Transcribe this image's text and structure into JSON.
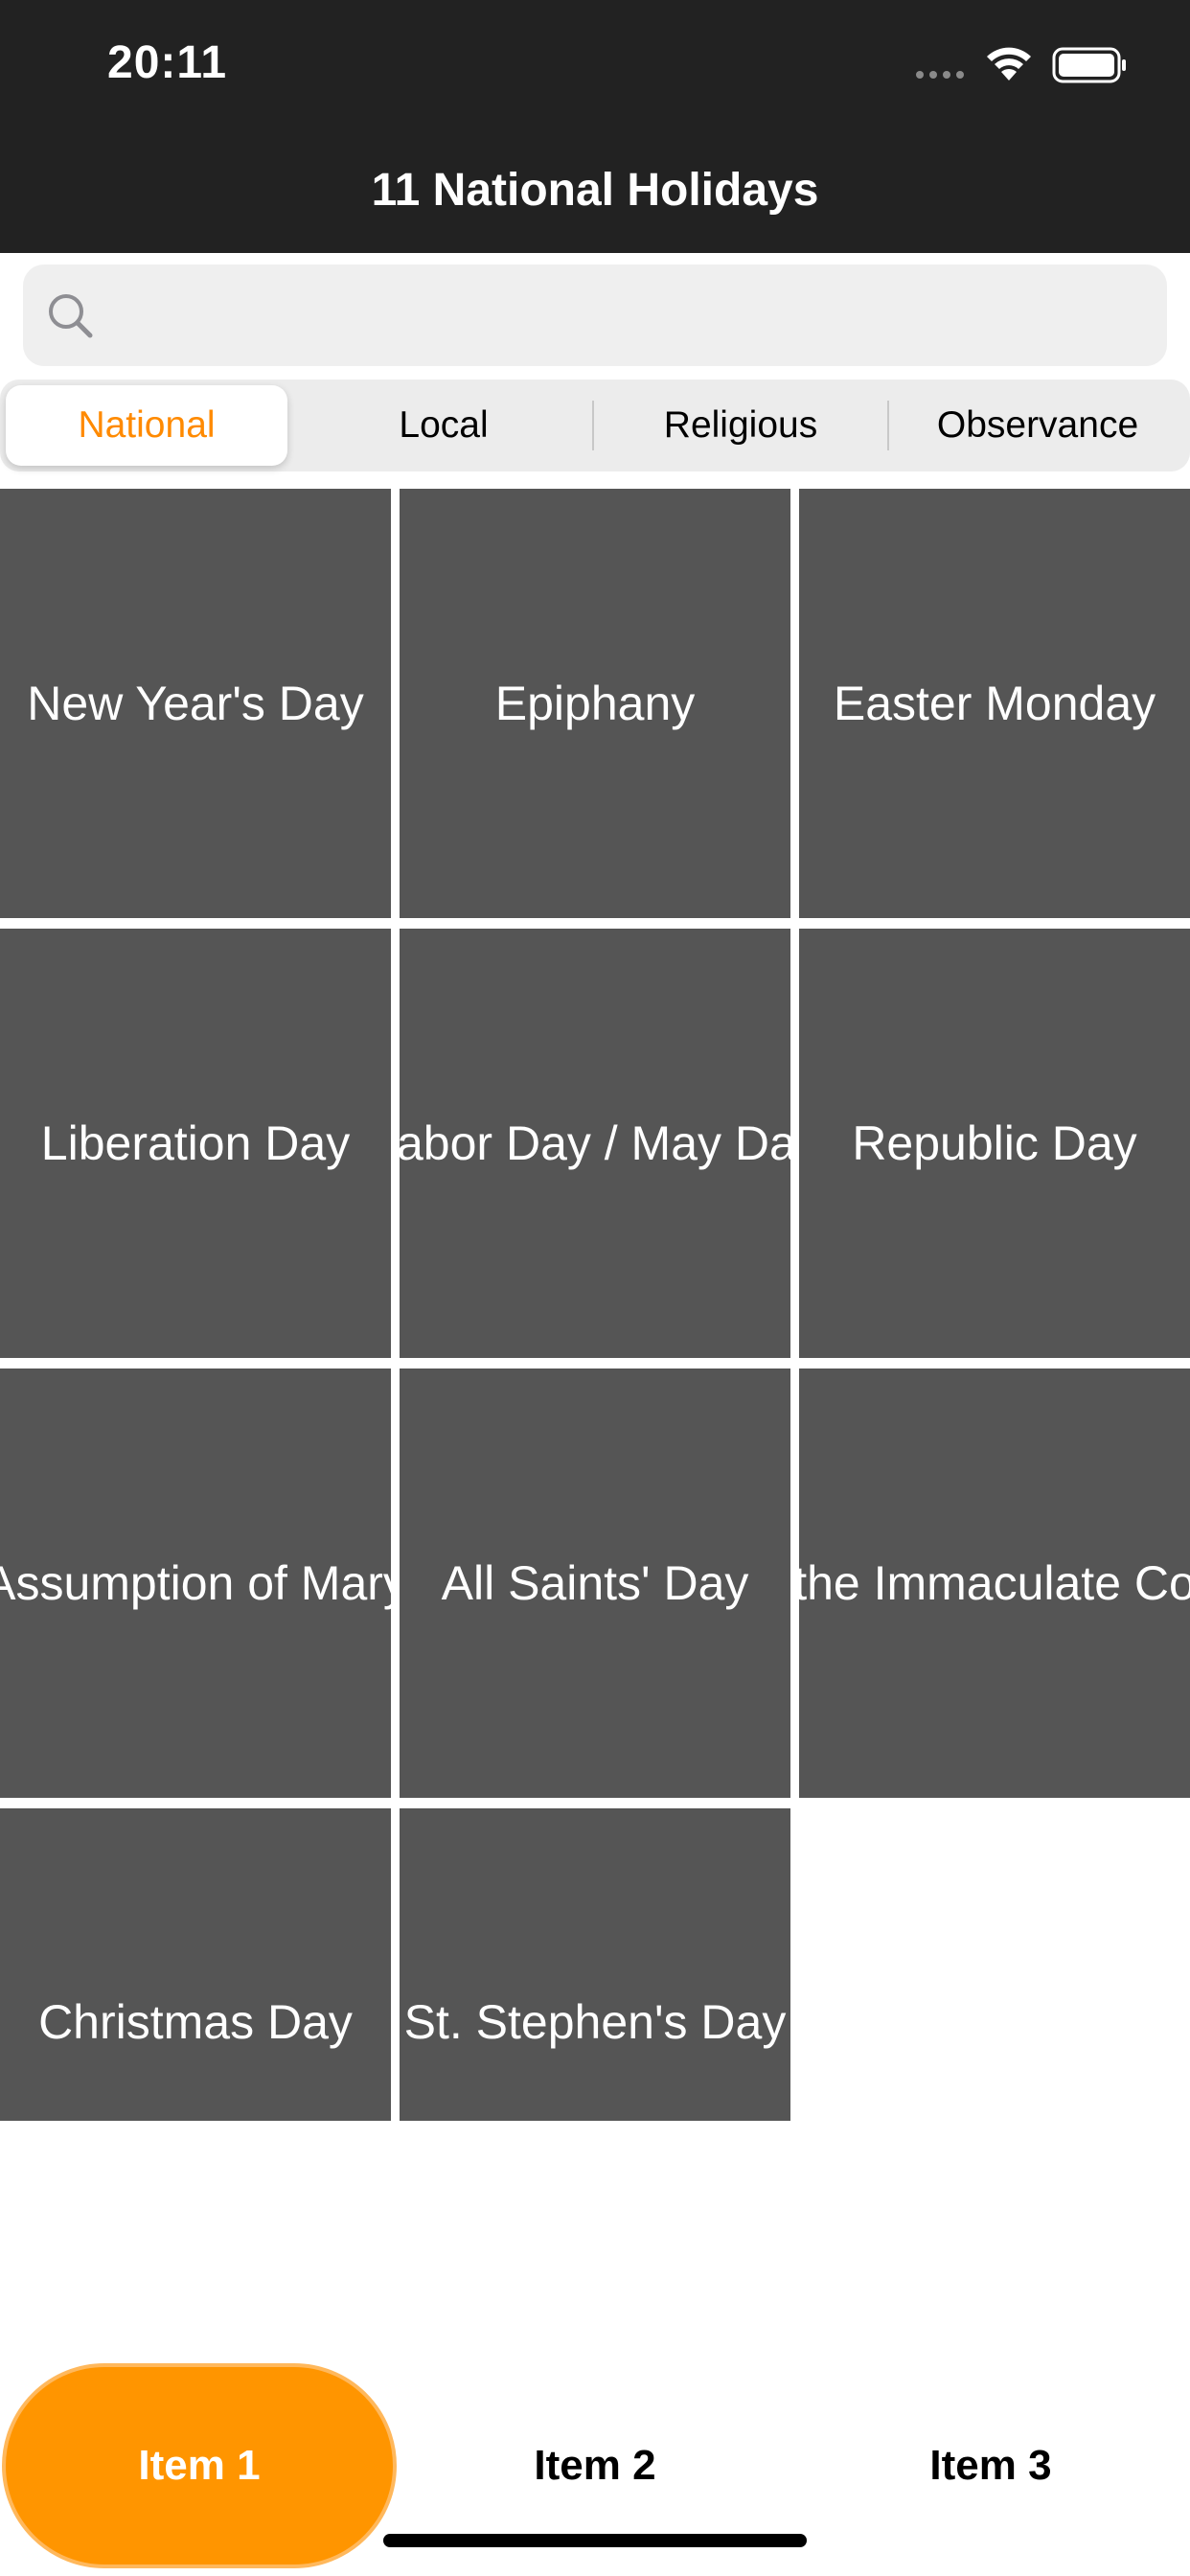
{
  "status_bar": {
    "time": "20:11"
  },
  "nav": {
    "title": "11 National Holidays"
  },
  "search": {
    "value": "",
    "placeholder": ""
  },
  "segments": [
    "National",
    "Local",
    "Religious",
    "Observance"
  ],
  "holidays": [
    "New Year's Day",
    "Epiphany",
    "Easter Monday",
    "Liberation Day",
    "Labor Day / May Day",
    "Republic Day",
    "Assumption of Mary",
    "All Saints' Day",
    "the Immaculate Co",
    "Christmas Day",
    "St. Stephen's Day"
  ],
  "tabs": [
    "Item 1",
    "Item 2",
    "Item 3"
  ],
  "colors": {
    "accent": "#ff9500",
    "tile": "#555555",
    "bar": "#222222"
  }
}
